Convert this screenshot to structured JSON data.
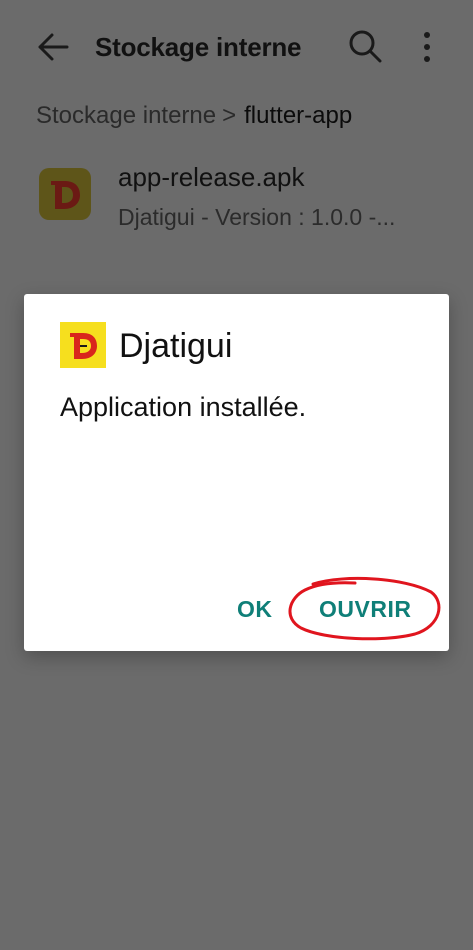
{
  "appbar": {
    "title": "Stockage interne",
    "back_icon": "back-arrow-icon",
    "search_icon": "search-icon",
    "more_icon": "more-vert-icon"
  },
  "breadcrumb": {
    "root": "Stockage interne",
    "separator": ">",
    "current": "flutter-app"
  },
  "file": {
    "name": "app-release.apk",
    "meta": "Djatigui - Version : 1.0.0 -..."
  },
  "dialog": {
    "app_name": "Djatigui",
    "message": "Application installée.",
    "ok_label": "OK",
    "open_label": "OUVRIR"
  },
  "colors": {
    "scrim": "#6b6b6b",
    "accent": "#0f7f78",
    "logo_yellow": "#f6df1e",
    "logo_red": "#d9261c",
    "annotation_red": "#e0151e"
  }
}
